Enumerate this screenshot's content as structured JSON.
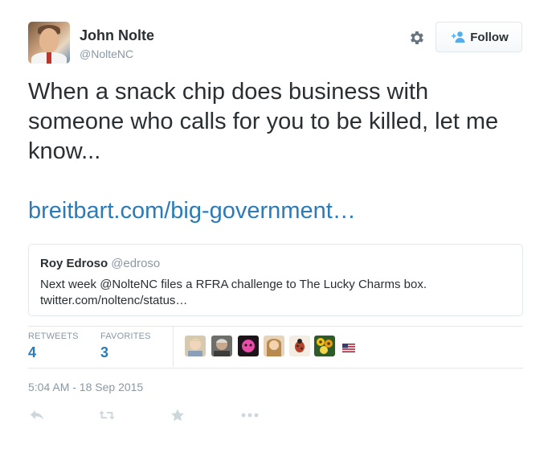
{
  "author": {
    "name": "John Nolte",
    "handle": "@NolteNC"
  },
  "follow_button": {
    "label": "Follow",
    "icon": "add-user-icon"
  },
  "settings_icon": "gear-icon",
  "tweet": {
    "text": "When a snack chip does business with someone who calls for you to be killed, let me know...",
    "link": "breitbart.com/big-government…"
  },
  "quoted_tweet": {
    "name": "Roy Edroso",
    "handle": "@edroso",
    "text_line1": "Next week @NolteNC files a RFRA challenge to The Lucky Charms box.",
    "text_line2": "twitter.com/noltenc/status…"
  },
  "stats": {
    "retweets_label": "RETWEETS",
    "retweets_value": "4",
    "favorites_label": "FAVORITES",
    "favorites_value": "3"
  },
  "favoriters": [
    {
      "icon": "user-avatar",
      "color": "#c9b89a"
    },
    {
      "icon": "user-avatar",
      "color": "#8b8b88"
    },
    {
      "icon": "user-avatar",
      "color": "#d9439a"
    },
    {
      "icon": "user-avatar",
      "color": "#d6a15f"
    },
    {
      "icon": "ladybug-avatar",
      "color": "#a8563a"
    },
    {
      "icon": "flowers-avatar",
      "color": "#e0b31f"
    },
    {
      "icon": "us-flag-icon",
      "color": "#b22234"
    }
  ],
  "timestamp": "5:04 AM - 18 Sep 2015",
  "actions": [
    "reply-icon",
    "retweet-icon",
    "favorite-star-icon",
    "more-dots-icon"
  ],
  "colors": {
    "link": "#2b7bb9",
    "muted": "#8899a6",
    "text": "#292f33",
    "border": "#e1e8ed",
    "action_icon": "#ccd6dd"
  }
}
